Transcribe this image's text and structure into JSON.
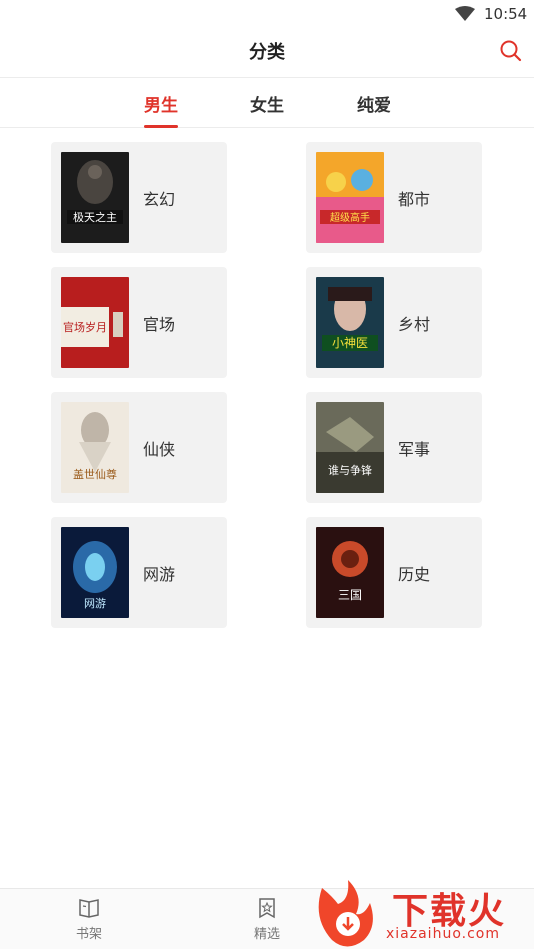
{
  "status": {
    "time": "10:54"
  },
  "header": {
    "title": "分类"
  },
  "tabs": [
    {
      "label": "男生",
      "active": true
    },
    {
      "label": "女生",
      "active": false
    },
    {
      "label": "纯爱",
      "active": false
    }
  ],
  "categories": [
    {
      "label": "玄幻",
      "cover_text": "极天之主"
    },
    {
      "label": "都市",
      "cover_text": "超级高手"
    },
    {
      "label": "官场",
      "cover_text": "官场岁月"
    },
    {
      "label": "乡村",
      "cover_text": "小神医"
    },
    {
      "label": "仙侠",
      "cover_text": "盖世仙尊"
    },
    {
      "label": "军事",
      "cover_text": "谁与争锋"
    },
    {
      "label": "网游",
      "cover_text": "网游"
    },
    {
      "label": "历史",
      "cover_text": "三国"
    }
  ],
  "bottom_nav": [
    {
      "label": "书架",
      "icon": "bookshelf-icon"
    },
    {
      "label": "精选",
      "icon": "featured-icon"
    }
  ],
  "watermark": {
    "text": "下载火",
    "url": "xiazaihuo.com"
  },
  "colors": {
    "accent": "#e0332a",
    "card_bg": "#f2f2f2"
  }
}
